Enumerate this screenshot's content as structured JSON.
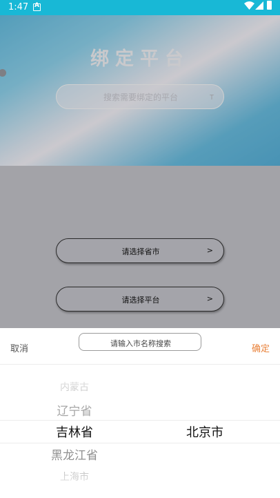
{
  "status_bar": {
    "time": "1:47"
  },
  "hero": {
    "title": "绑定平台",
    "search_placeholder": "搜索需要绑定的平台",
    "cursor": "T"
  },
  "selectors": [
    {
      "label": "请选择省市",
      "arrow": ">"
    },
    {
      "label": "请选择平台",
      "arrow": ">"
    }
  ],
  "sheet": {
    "cancel_label": "取消",
    "confirm_label": "确定",
    "search_placeholder": "请输入市名称搜索",
    "provinces": [
      "内蒙古",
      "辽宁省",
      "吉林省",
      "黑龙江省",
      "上海市"
    ],
    "selected_province": "吉林省",
    "cities": [
      "北京市"
    ],
    "selected_city": "北京市"
  },
  "colors": {
    "status_bar": "#18b8d6",
    "confirm": "#e9823a",
    "overlay": "#a3a3a8"
  }
}
